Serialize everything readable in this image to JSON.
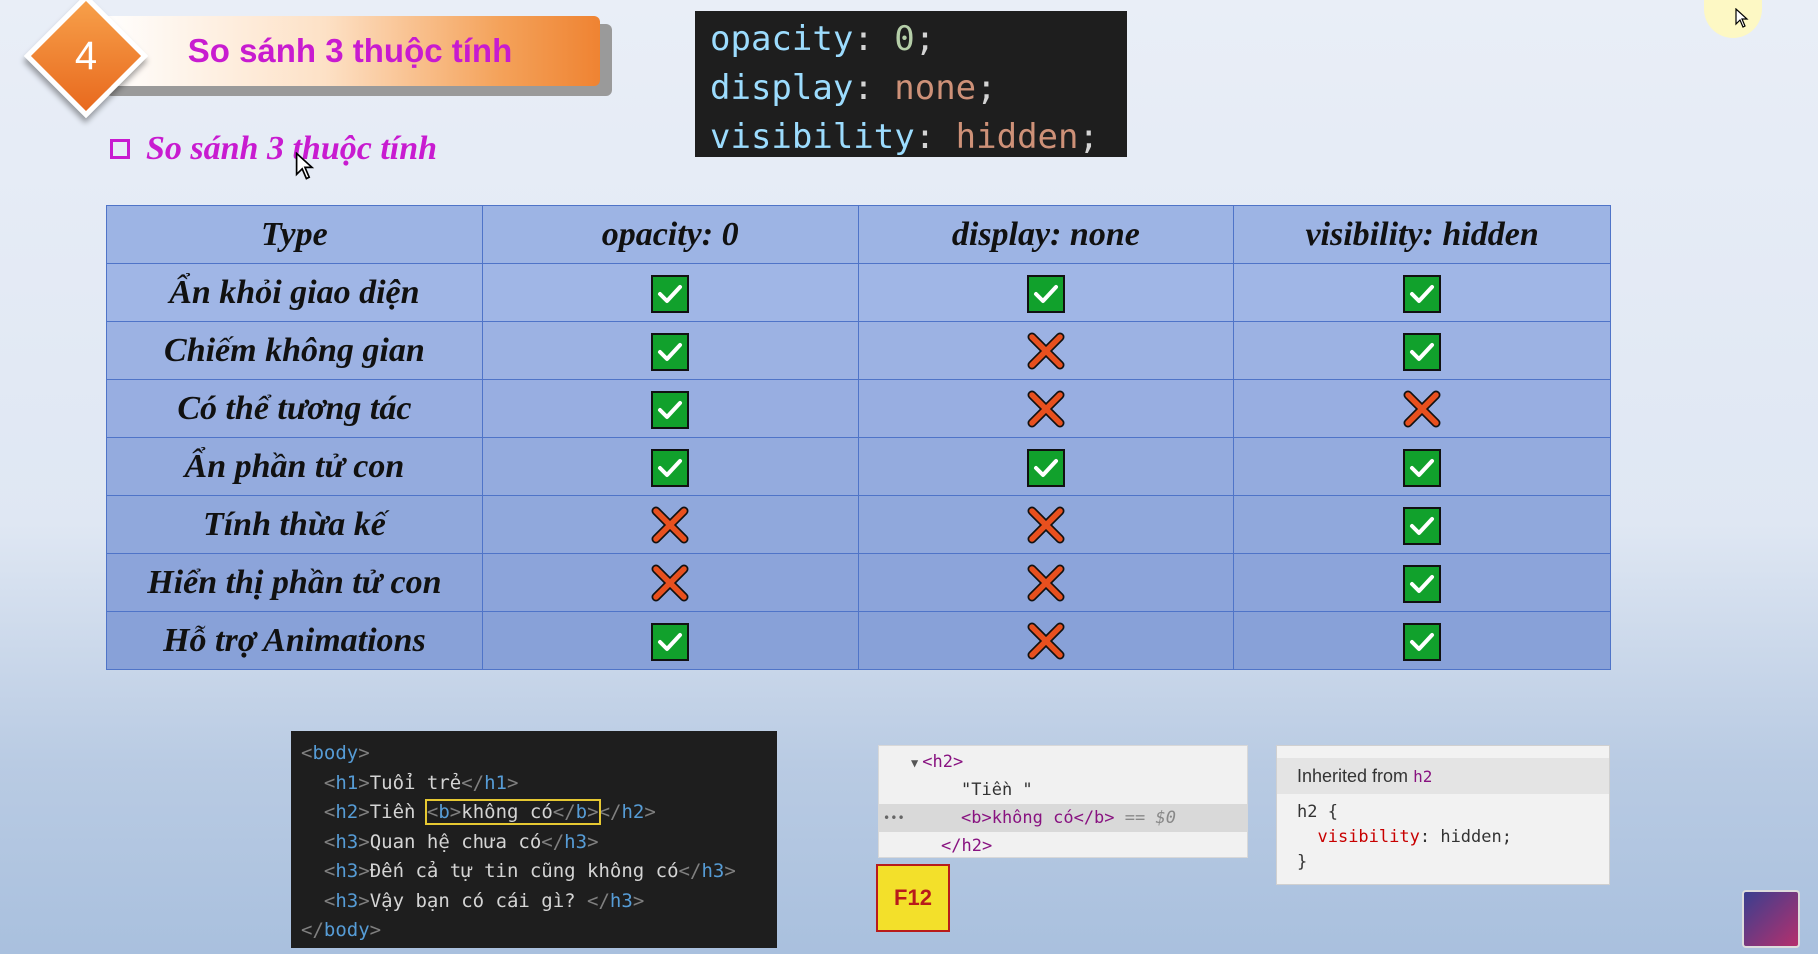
{
  "header": {
    "number": "4",
    "title": "So sánh 3 thuộc tính"
  },
  "code_top": {
    "lines": [
      {
        "prop": "opacity",
        "value": "0"
      },
      {
        "prop": "display",
        "value": "none"
      },
      {
        "prop": "visibility",
        "value": "hidden"
      }
    ]
  },
  "subtitle": "So sánh 3 thuộc tính",
  "table": {
    "headers": [
      "Type",
      "opacity: 0",
      "display: none",
      "visibility: hidden"
    ],
    "rows": [
      {
        "label": "Ẩn khỏi giao diện",
        "values": [
          "check",
          "check",
          "check"
        ]
      },
      {
        "label": "Chiếm không gian",
        "values": [
          "check",
          "cross",
          "check"
        ]
      },
      {
        "label": "Có thể tương tác",
        "values": [
          "check",
          "cross",
          "cross"
        ]
      },
      {
        "label": "Ẩn phần tử con",
        "values": [
          "check",
          "check",
          "check"
        ]
      },
      {
        "label": "Tính thừa kế",
        "values": [
          "cross",
          "cross",
          "check"
        ]
      },
      {
        "label": "Hiển thị phần tử con",
        "values": [
          "cross",
          "cross",
          "check"
        ]
      },
      {
        "label": "Hỗ trợ Animations",
        "values": [
          "check",
          "cross",
          "check"
        ]
      }
    ]
  },
  "code_bottom": {
    "body_open": "body",
    "h1_text": "Tuổi trẻ",
    "h2_text": "Tiền ",
    "b_text": "không có",
    "h3_a": "Quan hệ chưa có",
    "h3_b": "Đến cả tự tin cũng không có",
    "h3_c": "Vậy bạn có cái gì? ",
    "body_close": "body"
  },
  "devtools_dom": {
    "h2_open": "<h2>",
    "text_node": "\"Tiền \"",
    "b_node": "<b>không có</b>",
    "selected_marker": "== $0",
    "dots": "•••",
    "h2_close": "</h2>"
  },
  "f12_label": "F12",
  "styles_panel": {
    "inherited_label": "Inherited from",
    "inherited_tag": "h2",
    "selector": "h2 {",
    "property": "visibility",
    "value": "hidden;",
    "close": "}"
  },
  "colors": {
    "check": "#11a12c",
    "cross": "#e8501e",
    "accent": "#c81bd0",
    "badge": "#e8691e"
  }
}
